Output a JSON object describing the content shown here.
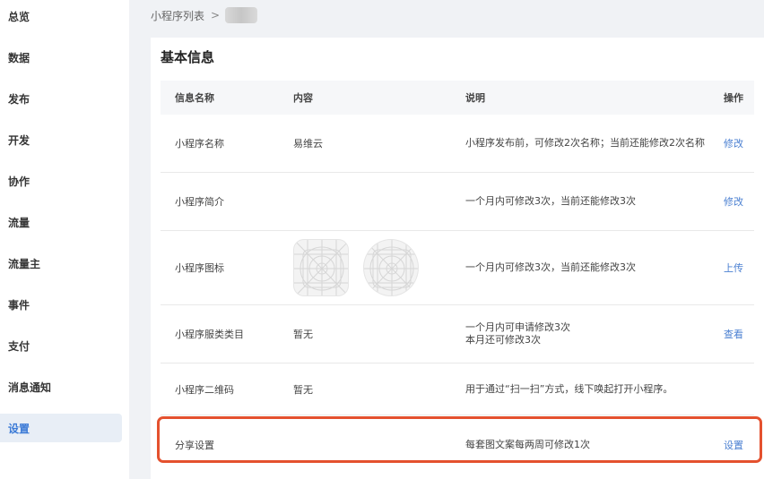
{
  "sidebar": {
    "items": [
      {
        "label": "总览"
      },
      {
        "label": "数据"
      },
      {
        "label": "发布"
      },
      {
        "label": "开发"
      },
      {
        "label": "协作"
      },
      {
        "label": "流量"
      },
      {
        "label": "流量主"
      },
      {
        "label": "事件"
      },
      {
        "label": "支付"
      },
      {
        "label": "消息通知"
      },
      {
        "label": "设置"
      }
    ],
    "active": "设置"
  },
  "breadcrumb": {
    "parent": "小程序列表",
    "separator": ">",
    "current_masked": true
  },
  "section": {
    "title": "基本信息"
  },
  "table": {
    "headers": [
      "信息名称",
      "内容",
      "说明",
      "操作"
    ],
    "rows": [
      {
        "name": "小程序名称",
        "content": "易维云",
        "desc": [
          "小程序发布前，可修改2次名称；当前还能修改2次名称"
        ],
        "action": "修改"
      },
      {
        "name": "小程序简介",
        "content": "",
        "desc": [
          "一个月内可修改3次，当前还能修改3次"
        ],
        "action": "修改"
      },
      {
        "name": "小程序图标",
        "content": "",
        "desc": [
          "一个月内可修改3次，当前还能修改3次"
        ],
        "action": "上传"
      },
      {
        "name": "小程序服类类目",
        "content": "暂无",
        "desc": [
          "一个月内可申请修改3次",
          "本月还可修改3次"
        ],
        "action": "查看"
      },
      {
        "name": "小程序二维码",
        "content": "暂无",
        "desc": [
          "用于通过“扫一扫”方式，线下唤起打开小程序。"
        ],
        "action": ""
      },
      {
        "name": "分享设置",
        "content": "",
        "desc": [
          "每套图文案每两周可修改1次"
        ],
        "action": "设置"
      }
    ]
  },
  "colors": {
    "accent": "#4a7fd1",
    "active_nav_bg": "#e8eef6",
    "highlight_border": "#e4512e",
    "page_bg": "#f0f2f5"
  }
}
